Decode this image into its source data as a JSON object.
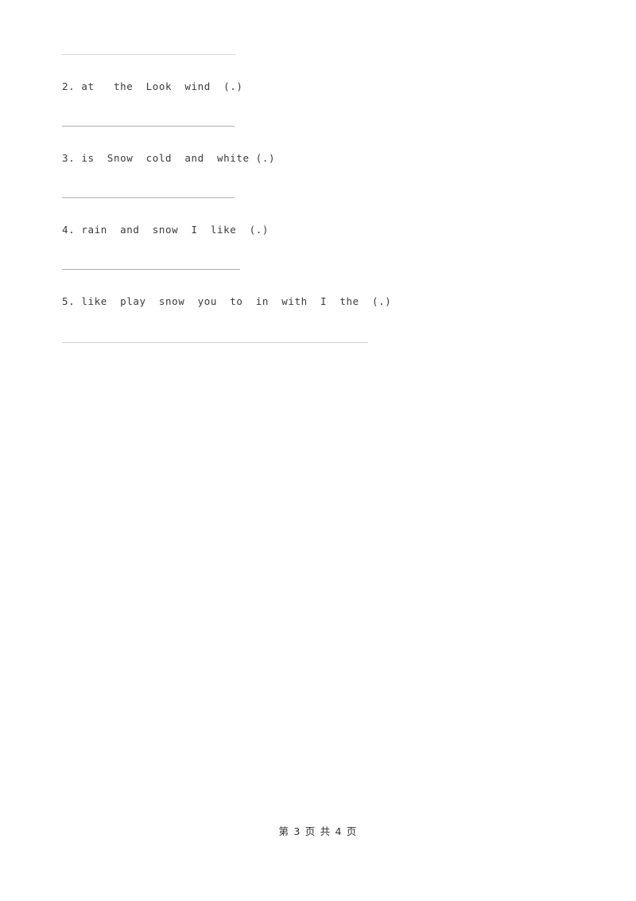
{
  "document": {
    "background_color": "#ffffff",
    "text_color": "#3a3a3a",
    "rule_color": "#b9b9b9"
  },
  "exercises": [
    {
      "number": "2.",
      "words": "at   the  Look  wind  (.)",
      "full": "2. at   the  Look  wind  (.)"
    },
    {
      "number": "3.",
      "words": "is  Snow  cold  and  white (.)",
      "full": "3. is  Snow  cold  and  white (.)"
    },
    {
      "number": "4.",
      "words": "rain  and  snow  I  like  (.)",
      "full": "4. rain  and  snow  I  like  (.)"
    },
    {
      "number": "5.",
      "words": "like  play  snow  you  to  in  with  I  the  (.)",
      "full": "5. like  play  snow  you  to  in  with  I  the  (.)"
    }
  ],
  "answer_lines": [
    {
      "id": "answer-line-1"
    },
    {
      "id": "answer-line-2"
    },
    {
      "id": "answer-line-3"
    },
    {
      "id": "answer-line-4"
    },
    {
      "id": "answer-line-5"
    }
  ],
  "footer": {
    "page_label": "第 3 页 共 4 页",
    "current_page": "3",
    "total_pages": "4"
  }
}
